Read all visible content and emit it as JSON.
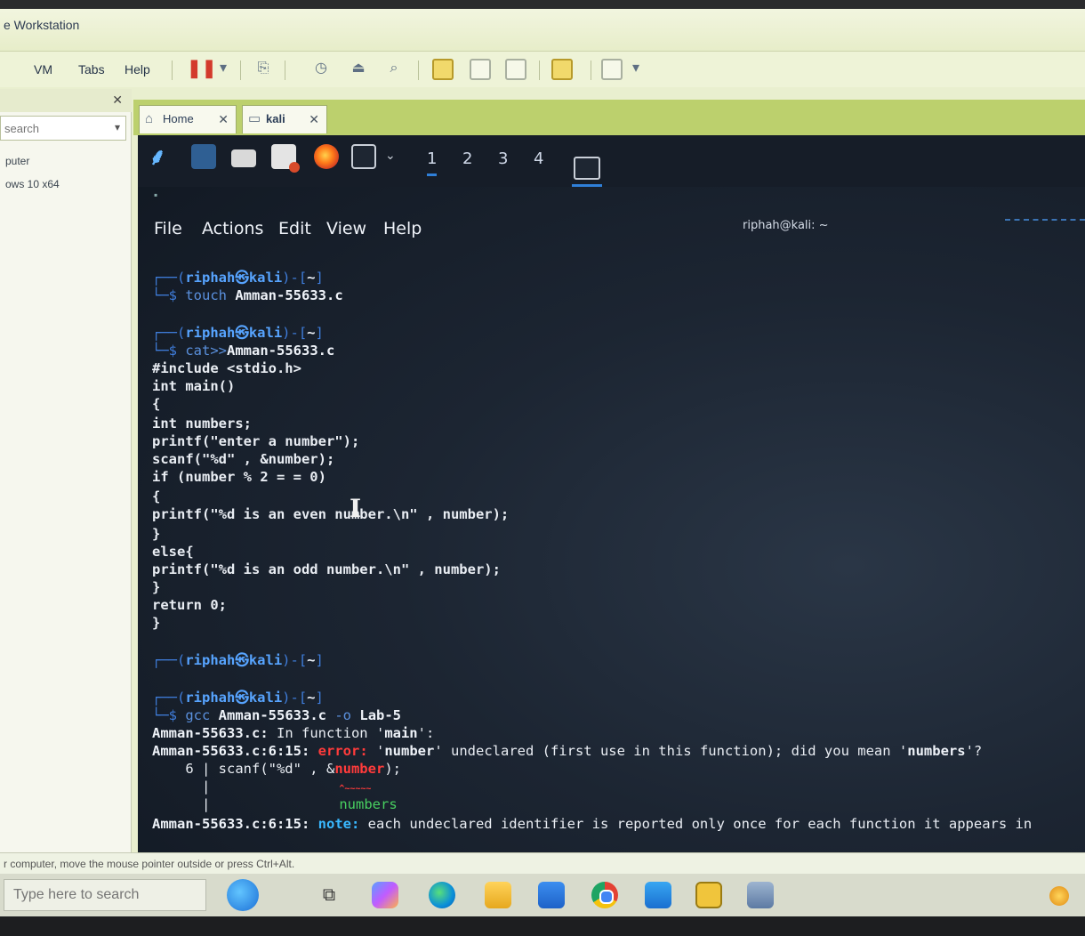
{
  "vmware": {
    "title": "e Workstation",
    "menu": [
      "VM",
      "Tabs",
      "Help"
    ],
    "library": {
      "search_placeholder": "search",
      "items": [
        "puter",
        "ows 10 x64"
      ]
    },
    "tabs": [
      {
        "label": "Home"
      },
      {
        "label": "kali"
      }
    ],
    "status_hint": "r computer, move the mouse pointer outside or press Ctrl+Alt."
  },
  "kali": {
    "workspaces": [
      "1",
      "2",
      "3",
      "4"
    ],
    "terminal": {
      "menu": [
        "File",
        "Actions",
        "Edit",
        "View",
        "Help"
      ],
      "title": "riphah@kali: ~",
      "prompt": {
        "user": "riphah",
        "sep": "㉿",
        "host": "kali",
        "dir": "~"
      },
      "commands": {
        "cmd1": "touch",
        "cmd1_arg": "Amman-55633.c",
        "cmd2": "cat>>",
        "cmd2_arg": "Amman-55633.c",
        "cmd3": "gcc",
        "cmd3_arg": "Amman-55633.c",
        "cmd3_opt": "-o",
        "cmd3_out": "Lab-5"
      },
      "code_lines": [
        "#include <stdio.h>",
        "int main()",
        "{",
        "int numbers;",
        "printf(\"enter a number\");",
        "scanf(\"%d\" , &number);",
        "if (number % 2 = = 0)",
        "{",
        "printf(\"%d is an even number.\\n\" , number);",
        "}",
        "else{",
        "printf(\"%d is an odd number.\\n\" , number);",
        "}",
        "return 0;",
        "}"
      ],
      "compiler": {
        "file_fn": "Amman-55633.c:",
        "in_function": " In function '",
        "fn_name": "main",
        "in_function_end": "':",
        "loc": "Amman-55633.c:6:15:",
        "error_label": "error:",
        "error_q1": " '",
        "error_ident": "number",
        "error_msg": "' undeclared (first use in this function); did you mean '",
        "error_suggest": "numbers",
        "error_end": "'?",
        "src_lineno": "    6 | ",
        "src_before": "scanf(\"%d\" , &",
        "src_ident": "number",
        "src_after": ");",
        "gutter": "      |",
        "caret": "^~~~~~",
        "suggestion": "numbers",
        "note_label": "note:",
        "note_msg": " each undeclared identifier is reported only once for each function it appears in"
      }
    }
  },
  "windows": {
    "search_placeholder": "Type here to search"
  }
}
